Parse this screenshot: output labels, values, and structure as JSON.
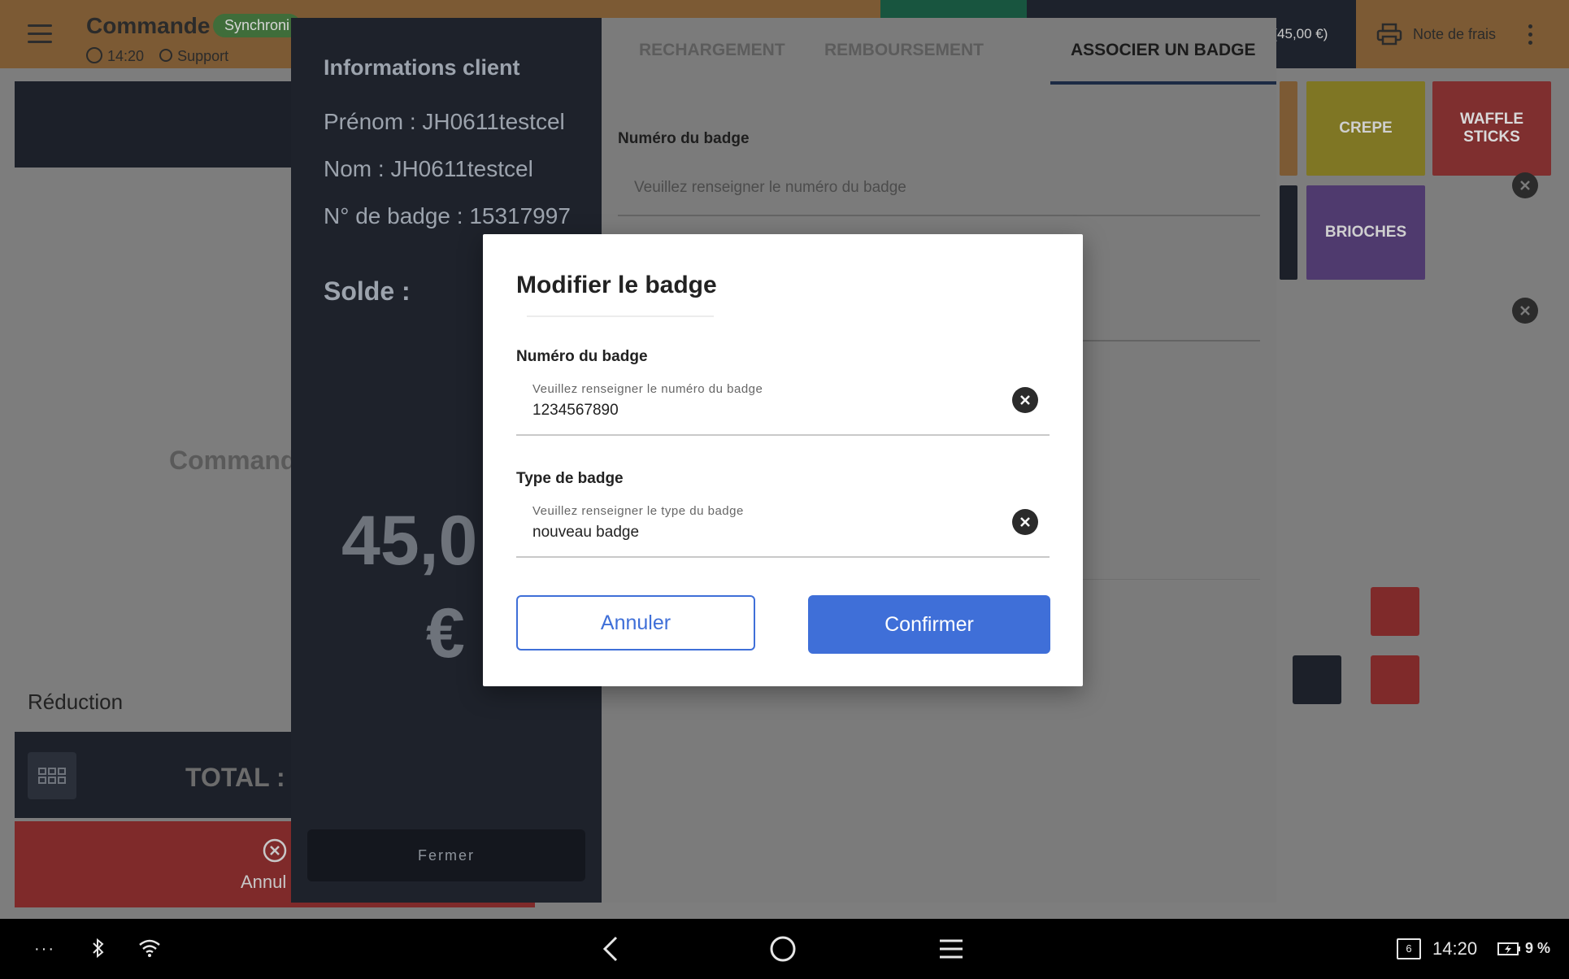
{
  "topbar": {
    "title": "Commande",
    "sync_badge": "Synchroni",
    "time": "14:20",
    "user": "Support",
    "amount": ") (45,00 €)",
    "note_label": "Note de frais"
  },
  "order_panel": {
    "commande_label": "Commande",
    "reduction_label": "Réduction",
    "total_label": "TOTAL : (",
    "cancel_label": "Annul"
  },
  "tiles": [
    {
      "label": "CREPE",
      "color": "#e0d13d"
    },
    {
      "label": "WAFFLE STICKS",
      "color": "#e25454"
    },
    {
      "label": "BRIOCHES",
      "color": "#8b66c4"
    }
  ],
  "customer": {
    "heading": "Informations client",
    "first_name": "Prénom : JH0611testcel",
    "last_name": "Nom : JH0611testcel",
    "badge_no": "N° de badge : 15317997",
    "balance_label": "Solde :",
    "balance_line1": "45,0",
    "balance_line2": "€",
    "close_label": "Fermer"
  },
  "tabs": [
    {
      "label": "RECHARGEMENT",
      "active": false
    },
    {
      "label": "REMBOURSEMENT",
      "active": false
    },
    {
      "label": "ASSOCIER UN BADGE",
      "active": true
    }
  ],
  "associate": {
    "badge_label": "Numéro du badge",
    "badge_placeholder": "Veuillez renseigner le numéro du badge"
  },
  "modal": {
    "title": "Modifier le badge",
    "badge_number": {
      "label": "Numéro du badge",
      "placeholder": "Veuillez renseigner le numéro du badge",
      "value": "1234567890"
    },
    "badge_type": {
      "label": "Type de badge",
      "placeholder": "Veuillez renseigner le type du badge",
      "value": "nouveau badge"
    },
    "cancel_label": "Annuler",
    "confirm_label": "Confirmer",
    "accent_color": "#3f6fd8"
  },
  "system_bar": {
    "time": "14:20",
    "battery": "9 %",
    "notif_count": "6"
  }
}
